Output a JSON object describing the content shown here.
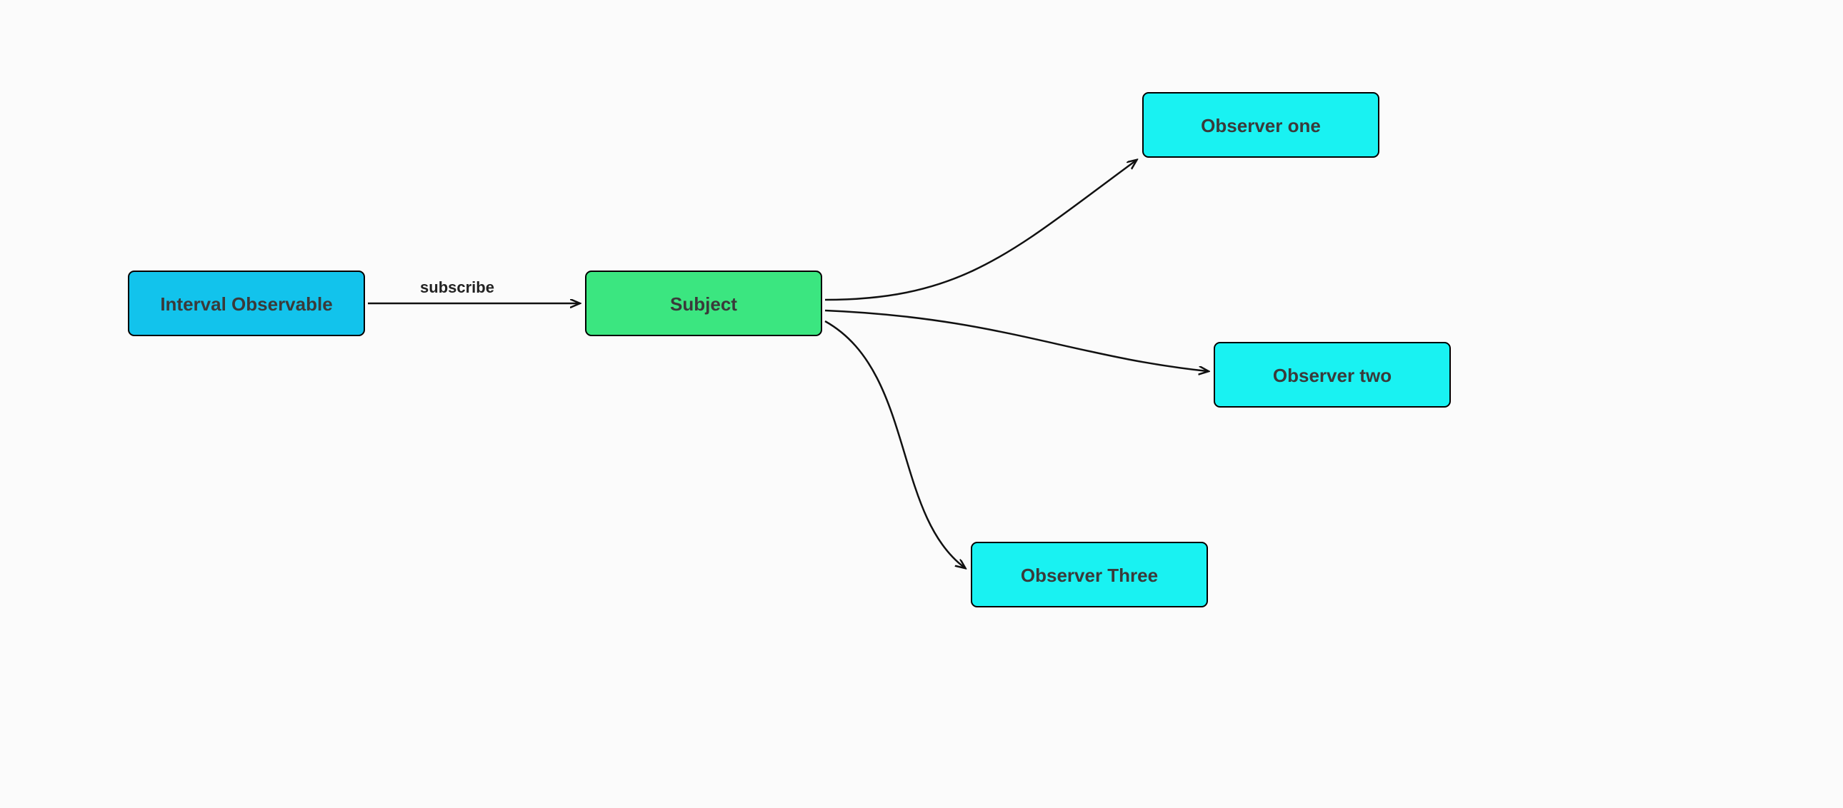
{
  "diagram": {
    "type": "flow",
    "nodes": {
      "source": {
        "label": "Interval Observable",
        "color": "#12c3ec"
      },
      "subject": {
        "label": "Subject",
        "color": "#3be680"
      },
      "obs1": {
        "label": "Observer one",
        "color": "#19f2f2"
      },
      "obs2": {
        "label": "Observer two",
        "color": "#19f2f2"
      },
      "obs3": {
        "label": "Observer Three",
        "color": "#19f2f2"
      }
    },
    "edges": {
      "subscribe": {
        "label": "subscribe"
      }
    }
  }
}
